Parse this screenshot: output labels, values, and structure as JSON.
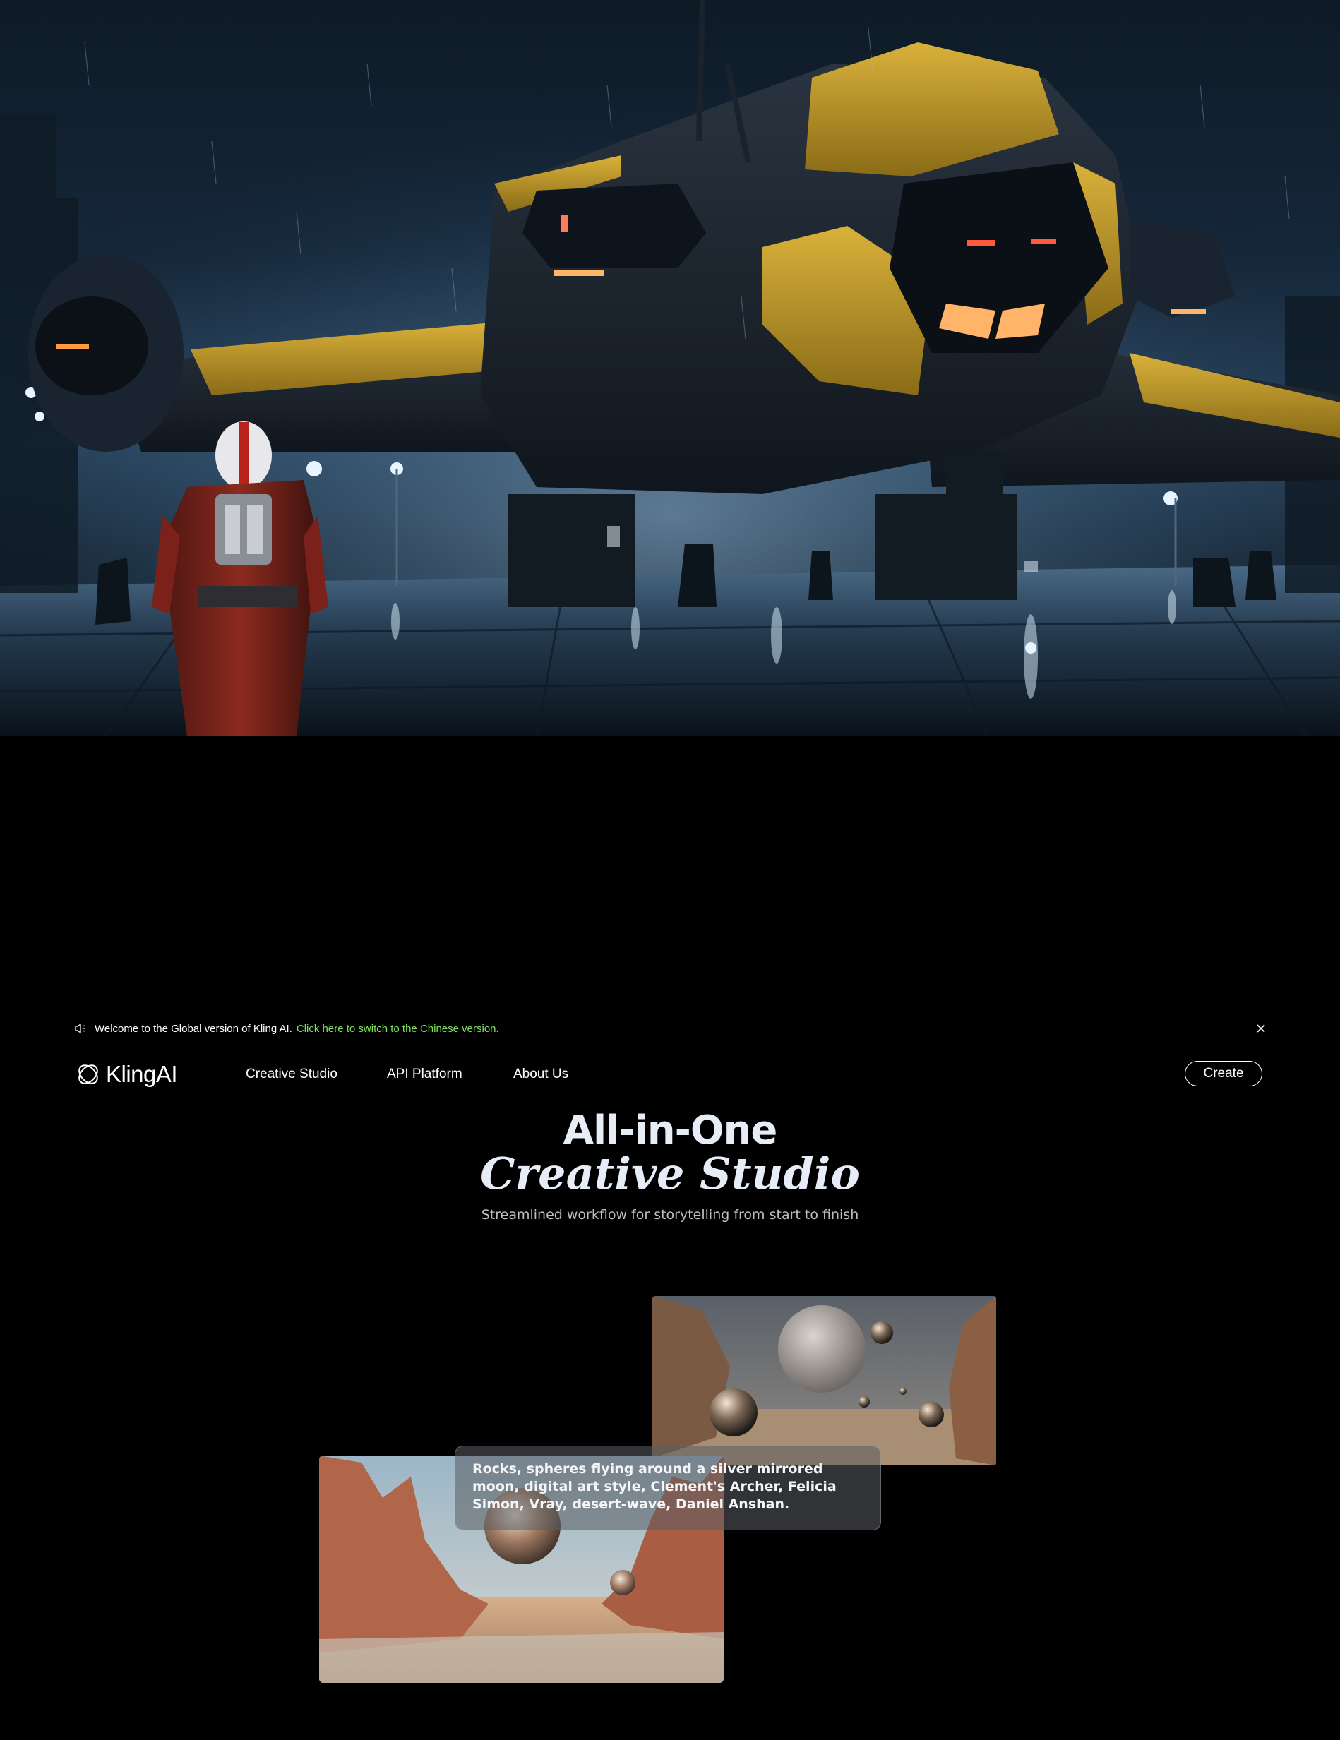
{
  "announcement": {
    "welcome_text": "Welcome to the Global version of Kling AI.",
    "switch_link": "Click here to switch to the Chinese version.",
    "icon": "speaker-icon",
    "close_icon": "close-icon"
  },
  "nav": {
    "logo_text": "KlingAI",
    "links": [
      "Creative Studio",
      "API Platform",
      "About Us"
    ],
    "create_label": "Create"
  },
  "hero": {
    "title_line1": "All-in-One",
    "title_line2": "Creative Studio",
    "subtitle": "Streamlined workflow for storytelling from start to finish"
  },
  "showcase": {
    "prompt": "Rocks, spheres flying around a silver mirrored moon, digital art style, Clement's Archer, Felicia Simon, Vray, desert-wave, Daniel Anshan."
  },
  "colors": {
    "background": "#000000",
    "link_accent": "#7ee35a",
    "heading": "#e6edf6",
    "subtitle": "#b8bec6"
  }
}
